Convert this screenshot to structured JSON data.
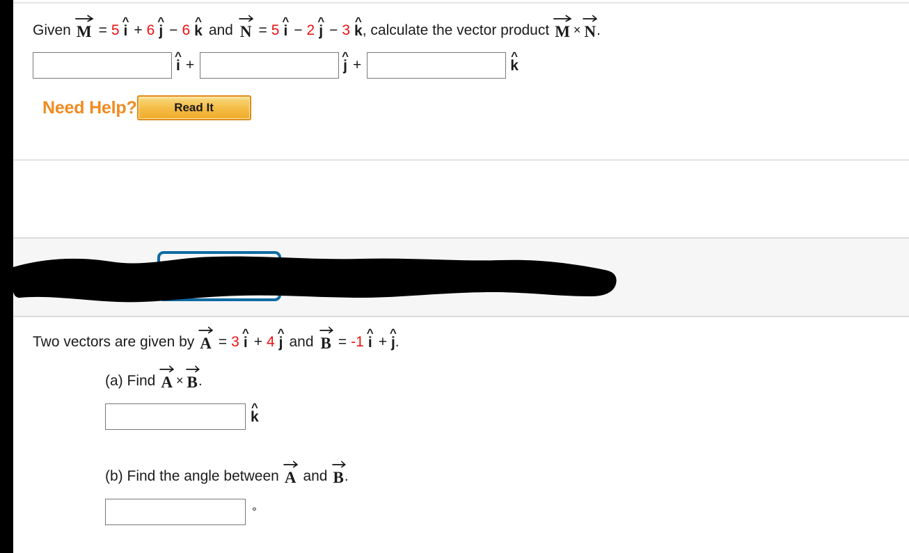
{
  "colors": {
    "accent_red": "#ee1111",
    "need_help_orange": "#ef8b20",
    "read_it_border": "#e08a18",
    "blue_outline": "#0f6ba3",
    "redaction_black": "#000000",
    "band_gray": "#f6f6f6",
    "rule_gray": "#e3e3e3"
  },
  "problem1": {
    "statement": {
      "lead": "Given",
      "vector_m": "M",
      "eq1": "=",
      "m_i_coef": "5",
      "m_i_hat": "i",
      "plus1": "+",
      "m_j_coef": "6",
      "m_j_hat": "j",
      "minus1": "−",
      "m_k_coef": "6",
      "m_k_hat": "k",
      "and": "and",
      "vector_n": "N",
      "eq2": "=",
      "n_i_coef": "5",
      "n_i_hat": "i",
      "minus2": "−",
      "n_j_coef": "2",
      "n_j_hat": "j",
      "minus3": "−",
      "n_k_coef": "3",
      "n_k_hat": "k",
      "tail": ", calculate the vector product",
      "prod_m": "M",
      "cross": "×",
      "prod_n": "N",
      "period": "."
    },
    "answer_row": {
      "field_i_value": "",
      "field_i_placeholder": "",
      "label_i": "i",
      "plus_a": "+",
      "field_j_value": "",
      "field_j_placeholder": "",
      "label_j": "j",
      "plus_b": "+",
      "field_k_value": "",
      "field_k_placeholder": "",
      "label_k": "k"
    },
    "need_help": {
      "label": "Need Help?",
      "read_it_button": "Read It"
    }
  },
  "redacted_band": {
    "note": "",
    "blue_box_label": ""
  },
  "problem2": {
    "statement": {
      "lead": "Two vectors are given by",
      "vector_a": "A",
      "eq1": "=",
      "a_i_coef": "3",
      "a_i_hat": "i",
      "plus1": "+",
      "a_j_coef": "4",
      "a_j_hat": "j",
      "and": "and",
      "vector_b": "B",
      "eq2": "=",
      "b_i_coef": "-1",
      "b_i_hat": "i",
      "plus2": "+",
      "b_j_hat": "j",
      "period": "."
    },
    "part_a": {
      "prompt_lead": "(a) Find",
      "vector_a": "A",
      "cross": "×",
      "vector_b": "B",
      "period": ".",
      "field_value": "",
      "field_placeholder": "",
      "unit_label": "k"
    },
    "part_b": {
      "prompt": "(b) Find the angle between",
      "vector_a": "A",
      "and": "and",
      "vector_b": "B",
      "period": ".",
      "field_value": "",
      "field_placeholder": "",
      "unit_label": "°"
    }
  }
}
